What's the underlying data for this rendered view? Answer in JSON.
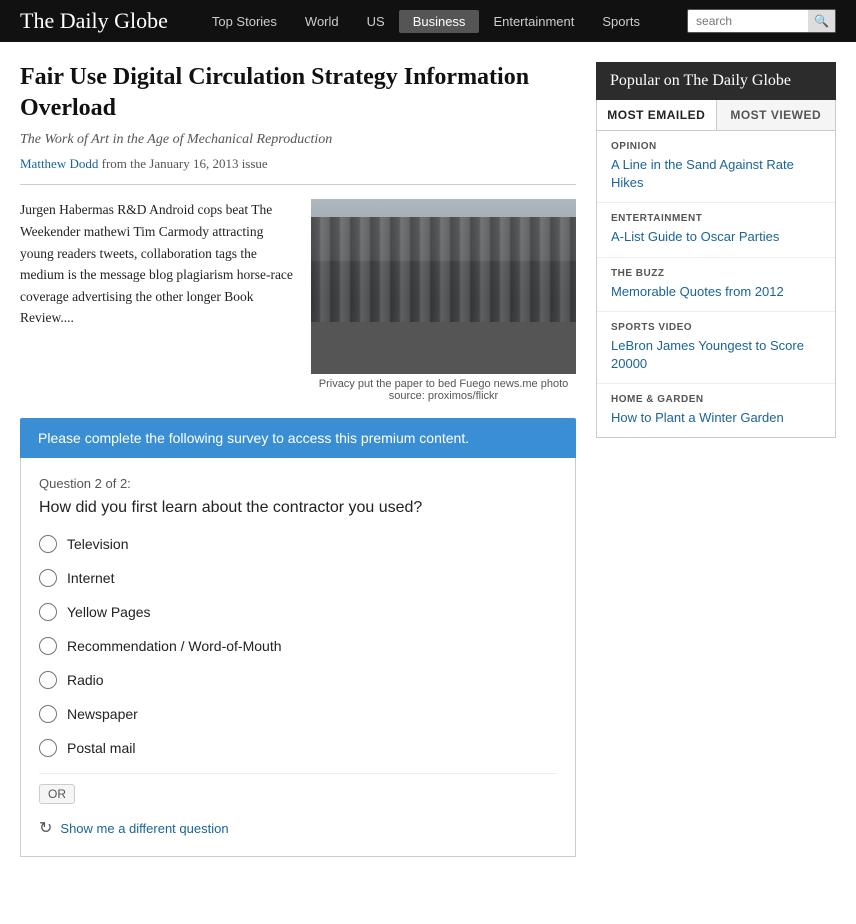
{
  "header": {
    "logo": "The Daily Globe",
    "nav_items": [
      {
        "label": "Top Stories",
        "active": false
      },
      {
        "label": "World",
        "active": false
      },
      {
        "label": "US",
        "active": false
      },
      {
        "label": "Business",
        "active": true
      },
      {
        "label": "Entertainment",
        "active": false
      },
      {
        "label": "Sports",
        "active": false
      }
    ],
    "search_placeholder": "search"
  },
  "article": {
    "title": "Fair Use Digital Circulation Strategy Information Overload",
    "subtitle": "The Work of Art in the Age of Mechanical Reproduction",
    "byline_author": "Matthew Dodd",
    "byline_rest": " from the January 16, 2013 issue",
    "body_text": "Jurgen Habermas R&D Android cops beat The Weekender mathewi Tim Carmody attracting young readers tweets, collaboration tags the medium is the message blog plagiarism horse-race coverage advertising the other longer Book Review....",
    "image_caption": "Privacy put the paper to bed Fuego news.me photo source: proximos/flickr"
  },
  "survey": {
    "banner": "Please complete the following survey to access this premium content.",
    "question_num": "Question 2 of 2:",
    "question": "How did you first learn about the contractor you used?",
    "options": [
      {
        "label": "Television"
      },
      {
        "label": "Internet"
      },
      {
        "label": "Yellow Pages"
      },
      {
        "label": "Recommendation / Word-of-Mouth"
      },
      {
        "label": "Radio"
      },
      {
        "label": "Newspaper"
      },
      {
        "label": "Postal mail"
      }
    ],
    "or_label": "OR",
    "refresh_label": "Show me a different question"
  },
  "sidebar": {
    "header": "Popular on The Daily Globe",
    "tabs": [
      {
        "label": "MOST EMAILED",
        "active": true
      },
      {
        "label": "MOST VIEWED",
        "active": false
      }
    ],
    "items": [
      {
        "category": "OPINION",
        "link": "A Line in the Sand Against Rate Hikes"
      },
      {
        "category": "ENTERTAINMENT",
        "link": "A-List Guide to Oscar Parties"
      },
      {
        "category": "THE BUZZ",
        "link": "Memorable Quotes from 2012"
      },
      {
        "category": "SPORTS VIDEO",
        "link": "LeBron James Youngest to Score 20000"
      },
      {
        "category": "HOME & GARDEN",
        "link": "How to Plant a Winter Garden"
      }
    ]
  }
}
